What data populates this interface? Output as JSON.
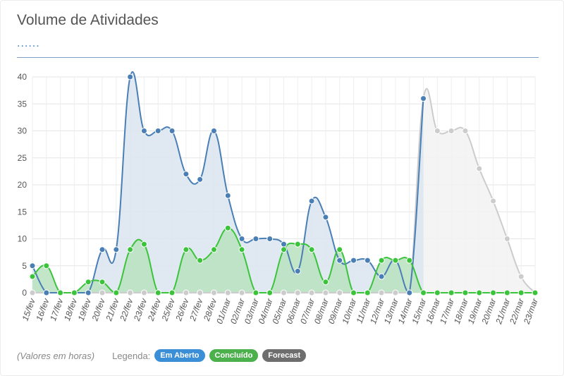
{
  "title": "Volume de Atividades",
  "subtitle": "......",
  "footer": {
    "note": "(Valores em horas)",
    "legend_label": "Legenda:",
    "badges": [
      {
        "label": "Em Aberto",
        "color": "#3a8fd6"
      },
      {
        "label": "Concluído",
        "color": "#4cb04c"
      },
      {
        "label": "Forecast",
        "color": "#6e6e6e"
      }
    ]
  },
  "chart_data": {
    "type": "area",
    "title": "Volume de Atividades",
    "ylim": [
      0,
      40
    ],
    "yticks": [
      0,
      5,
      10,
      15,
      20,
      25,
      30,
      35,
      40
    ],
    "grid": true,
    "categories": [
      "15/fev",
      "16/fev",
      "17/fev",
      "18/fev",
      "19/fev",
      "20/fev",
      "21/fev",
      "22/fev",
      "23/fev",
      "24/fev",
      "25/fev",
      "26/fev",
      "27/fev",
      "28/fev",
      "01/mar",
      "02/mar",
      "03/mar",
      "04/mar",
      "05/mar",
      "06/mar",
      "07/mar",
      "08/mar",
      "09/mar",
      "10/mar",
      "11/mar",
      "12/mar",
      "13/mar",
      "14/mar",
      "15/mar",
      "16/mar",
      "17/mar",
      "18/mar",
      "19/mar",
      "20/mar",
      "21/mar",
      "22/mar",
      "23/mar"
    ],
    "series": [
      {
        "name": "Em Aberto",
        "color": "#4a7fb5",
        "fill": "#dbe5f0",
        "x": [
          "15/fev",
          "16/fev",
          "17/fev",
          "18/fev",
          "19/fev",
          "20/fev",
          "21/fev",
          "22/fev",
          "23/fev",
          "24/fev",
          "25/fev",
          "26/fev",
          "27/fev",
          "28/fev",
          "01/mar",
          "02/mar",
          "03/mar",
          "04/mar",
          "05/mar",
          "06/mar",
          "07/mar",
          "08/mar",
          "09/mar",
          "10/mar",
          "11/mar",
          "12/mar",
          "13/mar",
          "14/mar",
          "15/mar"
        ],
        "values": [
          5,
          0,
          0,
          0,
          0,
          8,
          8,
          40,
          30,
          30,
          30,
          22,
          21,
          30,
          18,
          10,
          10,
          10,
          9,
          4,
          17,
          14,
          6,
          6,
          6,
          3,
          6,
          0,
          36
        ]
      },
      {
        "name": "Concluído",
        "color": "#3bc43b",
        "fill": "#b8e2c0",
        "x": [
          "15/fev",
          "16/fev",
          "17/fev",
          "18/fev",
          "19/fev",
          "20/fev",
          "21/fev",
          "22/fev",
          "23/fev",
          "24/fev",
          "25/fev",
          "26/fev",
          "27/fev",
          "28/fev",
          "01/mar",
          "02/mar",
          "03/mar",
          "04/mar",
          "05/mar",
          "06/mar",
          "07/mar",
          "08/mar",
          "09/mar",
          "10/mar",
          "11/mar",
          "12/mar",
          "13/mar",
          "14/mar",
          "15/mar",
          "16/mar",
          "17/mar",
          "18/mar",
          "19/mar",
          "20/mar",
          "21/mar",
          "22/mar",
          "23/mar"
        ],
        "values": [
          3,
          5,
          0,
          0,
          2,
          2,
          0,
          8,
          9,
          0,
          0,
          8,
          6,
          8,
          12,
          8,
          0,
          0,
          8,
          9,
          8,
          2,
          8,
          0,
          0,
          6,
          6,
          6,
          0,
          0,
          0,
          0,
          0,
          0,
          0,
          0,
          0
        ]
      },
      {
        "name": "Forecast",
        "color": "#cccccc",
        "fill": "#f2f2f2",
        "x": [
          "15/fev",
          "16/fev",
          "17/fev",
          "18/fev",
          "19/fev",
          "20/fev",
          "21/fev",
          "22/fev",
          "23/fev",
          "24/fev",
          "25/fev",
          "26/fev",
          "27/fev",
          "28/fev",
          "01/mar",
          "02/mar",
          "03/mar",
          "04/mar",
          "05/mar",
          "06/mar",
          "07/mar",
          "08/mar",
          "09/mar",
          "10/mar",
          "11/mar",
          "12/mar",
          "13/mar",
          "14/mar",
          "15/mar",
          "16/mar",
          "17/mar",
          "18/mar",
          "19/mar",
          "20/mar",
          "21/mar",
          "22/mar",
          "23/mar"
        ],
        "values": [
          0,
          0,
          0,
          0,
          0,
          0,
          0,
          0,
          0,
          0,
          0,
          0,
          0,
          0,
          0,
          0,
          0,
          0,
          0,
          0,
          0,
          0,
          0,
          0,
          0,
          0,
          0,
          0,
          36,
          30,
          30,
          30,
          23,
          17,
          10,
          3,
          0
        ]
      }
    ]
  }
}
